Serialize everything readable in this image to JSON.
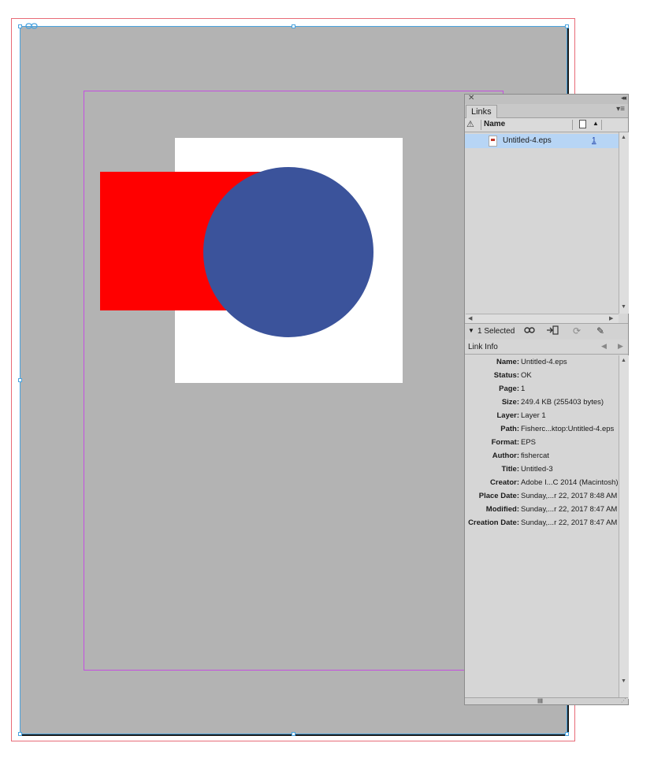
{
  "colors": {
    "canvas": "#b3b3b3",
    "bleed_guide": "#e86b77",
    "margin_guide": "#c44fe0",
    "frame_edge": "#4aa3df",
    "red_shape": "#ff0000",
    "blue_shape": "#3b539b",
    "selected_row": "#b7d5f5"
  },
  "links_panel": {
    "tab_label": "Links",
    "column_name": "Name",
    "icons": {
      "close": "close-icon",
      "collapse": "double-chevron-icon",
      "menu": "panel-menu-icon",
      "warning": "warning-icon",
      "page": "page-icon",
      "sort": "sort-up-icon"
    },
    "items": [
      {
        "name": "Untitled-4.eps",
        "page": "1",
        "selected": true
      }
    ],
    "toolbar": {
      "selected_count": "1 Selected",
      "icons": [
        "relink-icon",
        "go-to-link-icon",
        "update-link-icon",
        "edit-original-icon"
      ]
    },
    "link_info": {
      "title": "Link Info",
      "fields": [
        {
          "label": "Name:",
          "value": "Untitled-4.eps"
        },
        {
          "label": "Status:",
          "value": "OK"
        },
        {
          "label": "Page:",
          "value": "1"
        },
        {
          "label": "Size:",
          "value": "249.4 KB (255403 bytes)"
        },
        {
          "label": "Layer:",
          "value": "Layer 1"
        },
        {
          "label": "Path:",
          "value": "Fisherc...ktop:Untitled-4.eps"
        },
        {
          "label": "Format:",
          "value": "EPS"
        },
        {
          "label": "Author:",
          "value": "fishercat"
        },
        {
          "label": "Title:",
          "value": "Untitled-3"
        },
        {
          "label": "Creator:",
          "value": "Adobe I...C 2014 (Macintosh)"
        },
        {
          "label": "Place Date:",
          "value": "Sunday,...r 22, 2017 8:48 AM"
        },
        {
          "label": "Modified:",
          "value": "Sunday,...r 22, 2017 8:47 AM"
        },
        {
          "label": "Creation Date:",
          "value": "Sunday,...r 22, 2017 8:47 AM"
        }
      ]
    }
  }
}
